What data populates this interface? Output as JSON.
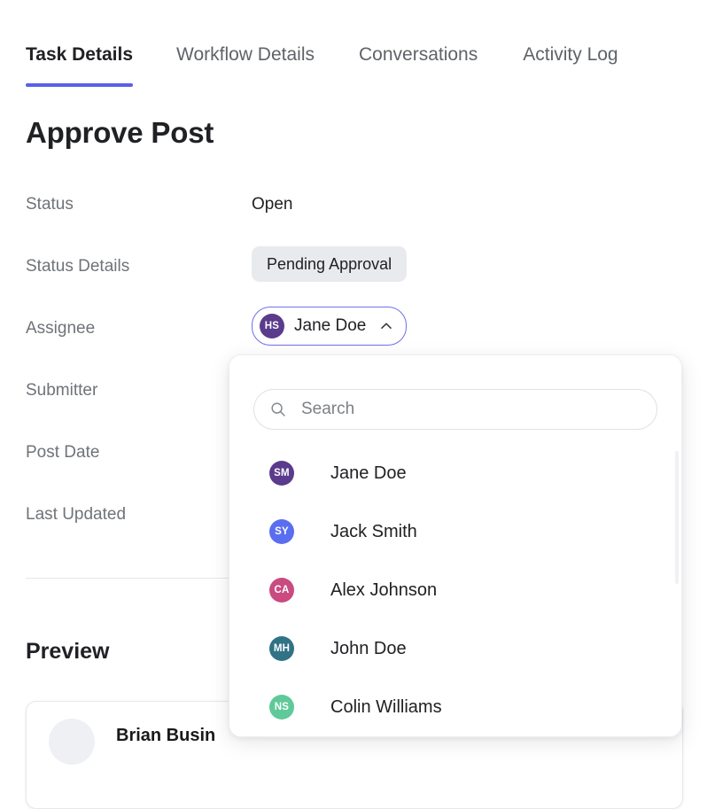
{
  "tabs": [
    {
      "label": "Task Details",
      "active": true
    },
    {
      "label": "Workflow Details",
      "active": false
    },
    {
      "label": "Conversations",
      "active": false
    },
    {
      "label": "Activity Log",
      "active": false
    }
  ],
  "page_title": "Approve Post",
  "details": {
    "rows": [
      {
        "label": "Status",
        "value": "Open",
        "kind": "text"
      },
      {
        "label": "Status Details",
        "value": "Pending Approval",
        "kind": "badge"
      },
      {
        "label": "Assignee",
        "value": "Jane Doe",
        "kind": "chip"
      },
      {
        "label": "Submitter",
        "value": "",
        "kind": "text"
      },
      {
        "label": "Post Date",
        "value": "",
        "kind": "text"
      },
      {
        "label": "Last Updated",
        "value": "",
        "kind": "text"
      }
    ]
  },
  "assignee_chip": {
    "name": "Jane Doe",
    "initials": "HS",
    "avatar_color": "#5b3b8c",
    "border_color": "#6f6ff0",
    "caret_icon": "chevron-up-icon"
  },
  "status_badge": {
    "label": "Pending Approval",
    "background": "#e8eaed",
    "text_color": "#202124"
  },
  "dropdown": {
    "search": {
      "placeholder": "Search",
      "value": "",
      "icon": "search-icon"
    },
    "options": [
      {
        "name": "Jane Doe",
        "initials": "SM",
        "color": "#5b3b8c"
      },
      {
        "name": "Jack Smith",
        "initials": "SY",
        "color": "#5a6ef0"
      },
      {
        "name": "Alex Johnson",
        "initials": "CA",
        "color": "#c94b80"
      },
      {
        "name": "John Doe",
        "initials": "MH",
        "color": "#317287"
      },
      {
        "name": "Colin Williams",
        "initials": "NS",
        "color": "#5fc99a"
      }
    ]
  },
  "preview": {
    "title": "Preview",
    "card": {
      "author": "Brian Busin",
      "avatar_icon": "user-avatar-placeholder"
    }
  },
  "theme": {
    "accent": "#5b5fe9",
    "label_color": "#6f7378",
    "text_color": "#202124",
    "background": "#ffffff"
  }
}
